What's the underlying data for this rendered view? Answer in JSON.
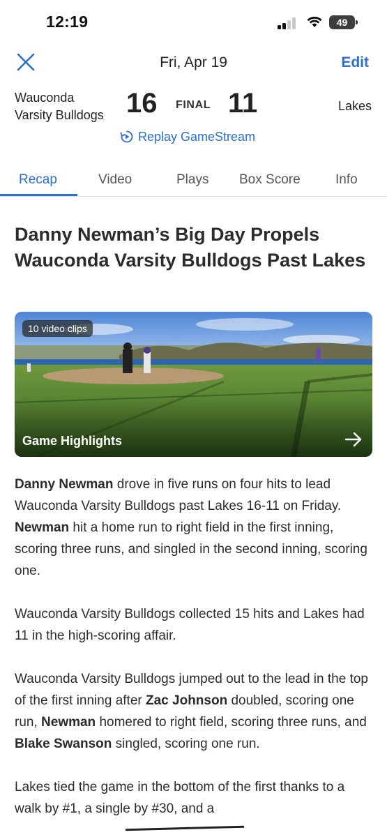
{
  "status_bar": {
    "time": "12:19",
    "battery": "49"
  },
  "nav": {
    "date": "Fri, Apr 19",
    "edit_label": "Edit"
  },
  "game": {
    "home_team_line1": "Wauconda",
    "home_team_line2": "Varsity Bulldogs",
    "home_score": "16",
    "status": "FINAL",
    "away_score": "11",
    "away_team": "Lakes",
    "replay_label": "Replay GameStream"
  },
  "tabs": [
    {
      "label": "Recap",
      "active": true
    },
    {
      "label": "Video"
    },
    {
      "label": "Plays"
    },
    {
      "label": "Box Score"
    },
    {
      "label": "Info"
    }
  ],
  "article": {
    "headline": "Danny Newman’s Big Day Propels Wauconda Varsity Bulldogs Past Lakes",
    "media": {
      "clip_count": "10 video clips",
      "title": "Game Highlights"
    },
    "p1": {
      "a": "Danny Newman",
      "b": " drove in five runs on four hits to lead Wauconda Varsity Bulldogs past Lakes 16-11 on Friday. ",
      "c": "Newman",
      "d": " hit a home run to right field in the first inning, scoring three runs, and singled in the second inning, scoring one."
    },
    "p2": "Wauconda Varsity Bulldogs collected 15 hits and Lakes had 11 in the high-scoring affair.",
    "p3": {
      "a": "Wauconda Varsity Bulldogs jumped out to the lead in the top of the first inning after ",
      "b": "Zac Johnson",
      "c": " doubled, scoring one run, ",
      "d": "Newman",
      "e": " homered to right field, scoring three runs, and ",
      "f": "Blake Swanson",
      "g": " singled, scoring one run."
    },
    "p4": "Lakes tied the game in the bottom of the first thanks to a walk by #1, a single by #30, and a"
  },
  "colors": {
    "accent": "#2a6fd6",
    "text": "#2b2b2b"
  }
}
